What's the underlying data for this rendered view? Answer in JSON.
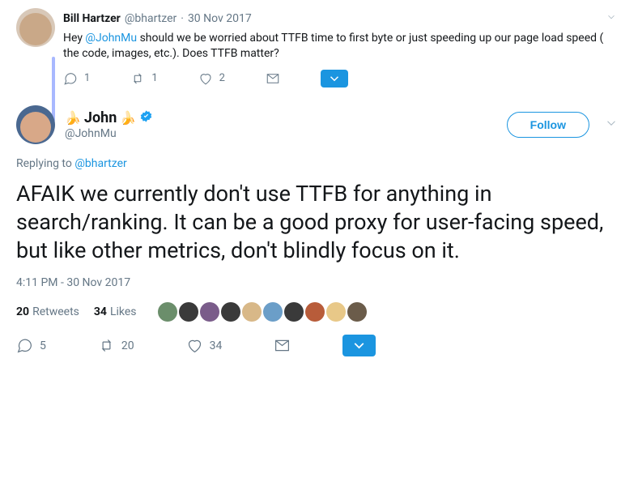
{
  "parent": {
    "display_name": "Bill Hartzer",
    "handle": "@bhartzer",
    "separator": "·",
    "date": "30 Nov 2017",
    "text_prefix": "Hey ",
    "mention": "@JohnMu",
    "text_suffix": " should we be worried about TTFB time to first byte or just speeding up our page load speed ( the code, images, etc.). Does TTFB matter?",
    "replies": "1",
    "retweets": "1",
    "likes": "2"
  },
  "main": {
    "emoji_left": "🍌",
    "display_name": "John",
    "emoji_right": "🍌",
    "handle": "@JohnMu",
    "follow_label": "Follow",
    "replying_prefix": "Replying to ",
    "replying_to": "@bhartzer",
    "text": "AFAIK we currently don't use TTFB for anything in search/ranking. It can be a good proxy for user-facing speed, but like other metrics, don't blindly focus on it.",
    "timestamp": "4:11 PM - 30 Nov 2017",
    "retweets_count": "20",
    "retweets_label": "Retweets",
    "likes_count": "34",
    "likes_label": "Likes",
    "replies": "5",
    "retweets_action": "20",
    "likes_action": "34"
  },
  "liker_colors": [
    "#6b8e6b",
    "#3a3a3a",
    "#7a5c8a",
    "#3a3a3a",
    "#d8b888",
    "#6b9ec8",
    "#3a3a3a",
    "#b85c3a",
    "#e8c888",
    "#6b5c4a"
  ]
}
